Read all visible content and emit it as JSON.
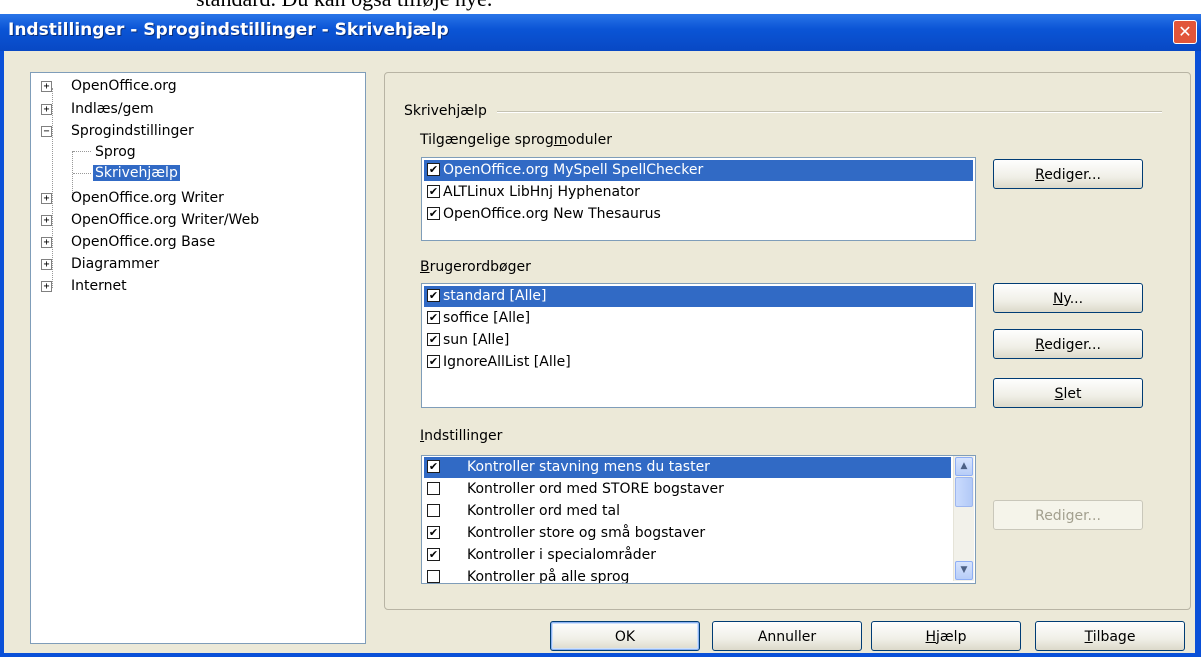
{
  "background_text": "standard. Du kan også tilføje nye.",
  "window": {
    "title": "Indstillinger - Sprogindstillinger - Skrivehjælp",
    "close_icon": "close-icon"
  },
  "tree": {
    "items": [
      {
        "label": "OpenOffice.org",
        "expander": "+"
      },
      {
        "label": "Indlæs/gem",
        "expander": "+"
      },
      {
        "label": "Sprogindstillinger",
        "expander": "−"
      },
      {
        "label": "Sprog",
        "expander": ""
      },
      {
        "label": "Skrivehjælp",
        "expander": "",
        "selected": true
      },
      {
        "label": "OpenOffice.org Writer",
        "expander": "+"
      },
      {
        "label": "OpenOffice.org Writer/Web",
        "expander": "+"
      },
      {
        "label": "OpenOffice.org Base",
        "expander": "+"
      },
      {
        "label": "Diagrammer",
        "expander": "+"
      },
      {
        "label": "Internet",
        "expander": "+"
      }
    ]
  },
  "panel": {
    "group_label": "Skrivehjælp",
    "modules": {
      "label_pre": "Tilgængelige sprog",
      "label_u": "m",
      "label_post": "oduler",
      "items": [
        {
          "label": "OpenOffice.org MySpell SpellChecker",
          "checked": true,
          "selected": true
        },
        {
          "label": "ALTLinux LibHnj Hyphenator",
          "checked": true
        },
        {
          "label": "OpenOffice.org New Thesaurus",
          "checked": true
        }
      ],
      "edit_button": {
        "pre": "",
        "u": "R",
        "post": "ediger..."
      }
    },
    "dictionaries": {
      "label_pre": "",
      "label_u": "B",
      "label_post": "rugerordbøger",
      "items": [
        {
          "label": "standard [Alle]",
          "checked": true,
          "selected": true
        },
        {
          "label": "soffice [Alle]",
          "checked": true
        },
        {
          "label": "sun [Alle]",
          "checked": true
        },
        {
          "label": "IgnoreAllList [Alle]",
          "checked": true
        }
      ],
      "new_button": {
        "pre": "",
        "u": "N",
        "post": "y..."
      },
      "edit_button": {
        "pre": "",
        "u": "R",
        "post": "ediger..."
      },
      "delete_button": {
        "pre": "",
        "u": "S",
        "post": "let"
      }
    },
    "options": {
      "label_pre": "",
      "label_u": "I",
      "label_post": "ndstillinger",
      "items": [
        {
          "label": "Kontroller stavning mens du taster",
          "checked": true,
          "selected": true
        },
        {
          "label": "Kontroller ord med STORE bogstaver",
          "checked": false
        },
        {
          "label": "Kontroller ord med tal",
          "checked": false
        },
        {
          "label": "Kontroller store og små bogstaver",
          "checked": true
        },
        {
          "label": "Kontroller i specialområder",
          "checked": true
        },
        {
          "label": "Kontroller på alle sprog",
          "checked": false
        }
      ],
      "edit_button": "Rediger..."
    }
  },
  "footer": {
    "ok": "OK",
    "cancel": "Annuller",
    "help": {
      "pre": "",
      "u": "H",
      "post": "jælp"
    },
    "back": {
      "pre": "",
      "u": "T",
      "post": "ilbage"
    }
  }
}
